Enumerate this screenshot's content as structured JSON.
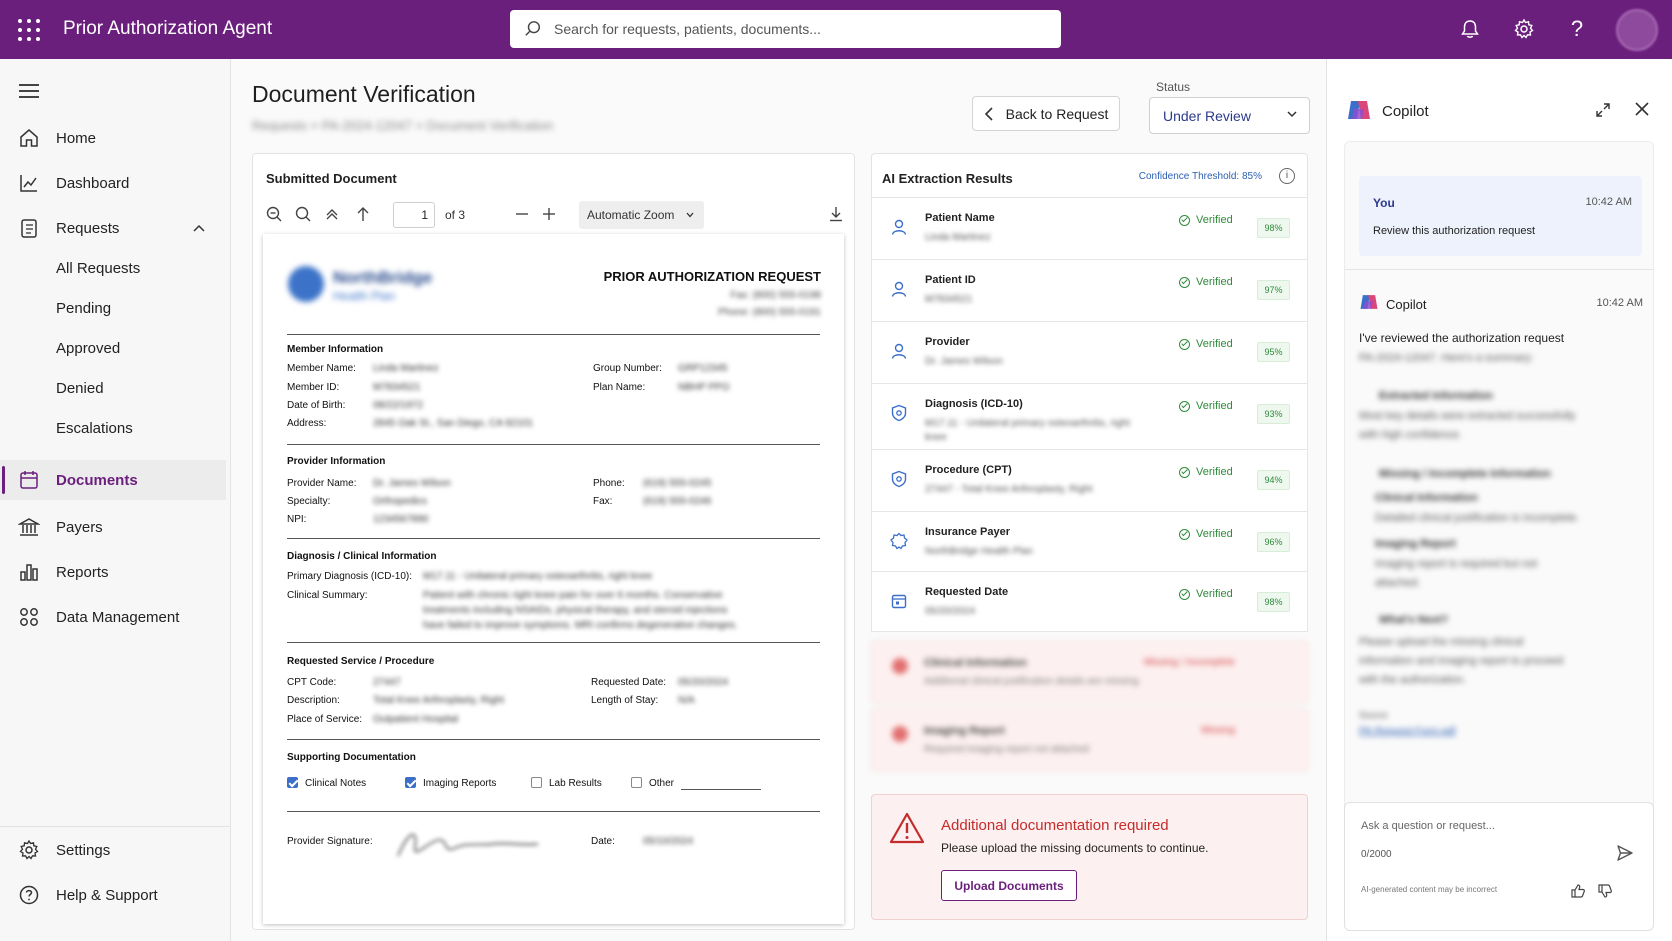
{
  "app": {
    "title": "Prior Authorization Agent",
    "search_placeholder": "Search for requests, patients, documents...",
    "accent": "#6b1f7c"
  },
  "nav": {
    "items": [
      {
        "label": "Home",
        "icon": "home-icon"
      },
      {
        "label": "Dashboard",
        "icon": "chart-line-icon"
      },
      {
        "label": "Requests",
        "icon": "clipboard-icon"
      },
      {
        "label": "Documents",
        "icon": "document-icon"
      },
      {
        "label": "Payers",
        "icon": "bank-icon"
      },
      {
        "label": "Reports",
        "icon": "bar-chart-icon"
      },
      {
        "label": "Data Management",
        "icon": "grid-icon"
      }
    ],
    "request_subitems": [
      "All Requests",
      "Pending",
      "Approved",
      "Denied",
      "Escalations"
    ],
    "bottom": [
      {
        "label": "Settings",
        "icon": "gear-icon"
      },
      {
        "label": "Help & Support",
        "icon": "help-circle-icon"
      }
    ],
    "active": "Documents"
  },
  "page": {
    "title": "Document Verification",
    "breadcrumb": "Requests  >  PA-2024-12047  >  Document Verification",
    "back_button": "Back to Request",
    "status_label": "Status",
    "status_value": "Under Review"
  },
  "doc_panel": {
    "title": "Submitted Document",
    "toolbar": {
      "page_current": "1",
      "page_of": "of 3",
      "zoom": "Automatic Zoom"
    },
    "sheet": {
      "org_name": "NorthBridge",
      "org_sub": "Health Plan",
      "heading": "PRIOR AUTHORIZATION REQUEST",
      "fax_line": "Fax: (800) 555-0198",
      "phone_line": "Phone: (800) 555-0191",
      "sections": {
        "member": {
          "heading": "Member Information",
          "member_name_label": "Member Name:",
          "member_name": "Linda Martinez",
          "member_id_label": "Member ID:",
          "member_id": "M7834521",
          "dob_label": "Date of Birth:",
          "dob": "08/22/1972",
          "address_label": "Address:",
          "address": "2845 Oak St., San Diego, CA 92101",
          "group_label": "Group Number:",
          "group": "GRP12345",
          "plan_label": "Plan Name:",
          "plan": "NBHP PPO"
        },
        "provider": {
          "heading": "Provider Information",
          "name_label": "Provider Name:",
          "name": "Dr. James Wilson",
          "specialty_label": "Specialty:",
          "specialty": "Orthopedics",
          "npi_label": "NPI:",
          "npi": "1234567890",
          "phone_label": "Phone:",
          "phone": "(619) 555-0245",
          "fax_label": "Fax:",
          "fax": "(619) 555-0246"
        },
        "diagnosis": {
          "heading": "Diagnosis / Clinical Information",
          "primary_label": "Primary Diagnosis (ICD-10):",
          "primary": "M17.11 - Unilateral primary osteoarthritis, right knee",
          "summary_label": "Clinical Summary:",
          "summary_lines": [
            "Patient with chronic right knee pain for over 6 months. Conservative",
            "treatments including NSAIDs, physical therapy, and steroid injections",
            "have failed to improve symptoms. MRI confirms degenerative changes."
          ]
        },
        "service": {
          "heading": "Requested Service / Procedure",
          "cpt_label": "CPT Code:",
          "cpt": "27447",
          "desc_label": "Description:",
          "desc": "Total Knee Arthroplasty, Right",
          "place_label": "Place of Service:",
          "place": "Outpatient Hospital",
          "date_label": "Requested Date:",
          "date": "05/20/2024",
          "los_label": "Length of Stay:",
          "los": "N/A"
        },
        "supporting": {
          "heading": "Supporting Documentation",
          "items": [
            {
              "label": "Clinical Notes",
              "checked": true
            },
            {
              "label": "Imaging Reports",
              "checked": true
            },
            {
              "label": "Lab Results",
              "checked": false
            },
            {
              "label": "Other",
              "checked": false
            }
          ]
        },
        "signature": {
          "sig_label": "Provider Signature:",
          "date_label": "Date:",
          "date": "05/10/2024"
        }
      }
    }
  },
  "ai_panel": {
    "title": "AI Extraction Results",
    "confidence_threshold": "Confidence Threshold: 85%",
    "verified_label": "Verified",
    "rows": [
      {
        "name": "Patient Name",
        "value": "Linda Martinez",
        "pct": "98%",
        "icon": "person-icon"
      },
      {
        "name": "Patient ID",
        "value": "M7834521",
        "pct": "97%",
        "icon": "person-icon"
      },
      {
        "name": "Provider",
        "value": "Dr. James Wilson",
        "pct": "95%",
        "icon": "person-icon"
      },
      {
        "name": "Diagnosis (ICD-10)",
        "value": "M17.11 - Unilateral primary osteoarthritis, right",
        "value2": "knee",
        "pct": "93%",
        "icon": "shield-icon"
      },
      {
        "name": "Procedure (CPT)",
        "value": "27447 - Total Knee Arthroplasty, Right",
        "pct": "94%",
        "icon": "shield-icon"
      },
      {
        "name": "Insurance Payer",
        "value": "NorthBridge Health Plan",
        "pct": "96%",
        "icon": "badge-icon"
      },
      {
        "name": "Requested Date",
        "value": "05/20/2024",
        "pct": "98%",
        "icon": "calendar-icon"
      }
    ],
    "missing": [
      {
        "name": "Clinical Information",
        "value": "Additional clinical justification details are missing",
        "tag": "Missing / Incomplete"
      },
      {
        "name": "Imaging Report",
        "value": "Required imaging report not attached",
        "tag": "Missing"
      }
    ],
    "alert": {
      "title": "Additional documentation required",
      "text": "Please upload the missing documents to continue.",
      "button": "Upload Documents"
    }
  },
  "copilot": {
    "title": "Copilot",
    "you": {
      "who": "You",
      "time": "10:42 AM",
      "msg": "Review this authorization request"
    },
    "reply": {
      "who": "Copilot",
      "time": "10:42 AM",
      "msg": "I've reviewed the authorization request",
      "blurred_lines": [
        {
          "text": "PA-2024-12047. Here's a summary:",
          "bold": false
        },
        {
          "text": "Extracted Information",
          "bold": true
        },
        {
          "text": "Most key details were extracted successfully",
          "bold": false
        },
        {
          "text": "with high confidence.",
          "bold": false
        },
        {
          "text": "Missing / Incomplete Information",
          "bold": true
        },
        {
          "text": "Clinical Information",
          "bold": true
        },
        {
          "text": "Detailed clinical justification is incomplete.",
          "bold": false
        },
        {
          "text": "Imaging Report",
          "bold": true
        },
        {
          "text": "Imaging report is required but not",
          "bold": false
        },
        {
          "text": "attached.",
          "bold": false
        },
        {
          "text": "What's Next?",
          "bold": true
        },
        {
          "text": "Please upload the missing clinical",
          "bold": false
        },
        {
          "text": "information and imaging report to proceed",
          "bold": false
        },
        {
          "text": "with the authorization.",
          "bold": false
        },
        {
          "text": "Source",
          "bold": false
        }
      ],
      "link": "PA-Request-Form.pdf"
    },
    "input_placeholder": "Ask a question or request...",
    "char_count": "0/2000",
    "disclaimer": "AI-generated content may be incorrect"
  }
}
